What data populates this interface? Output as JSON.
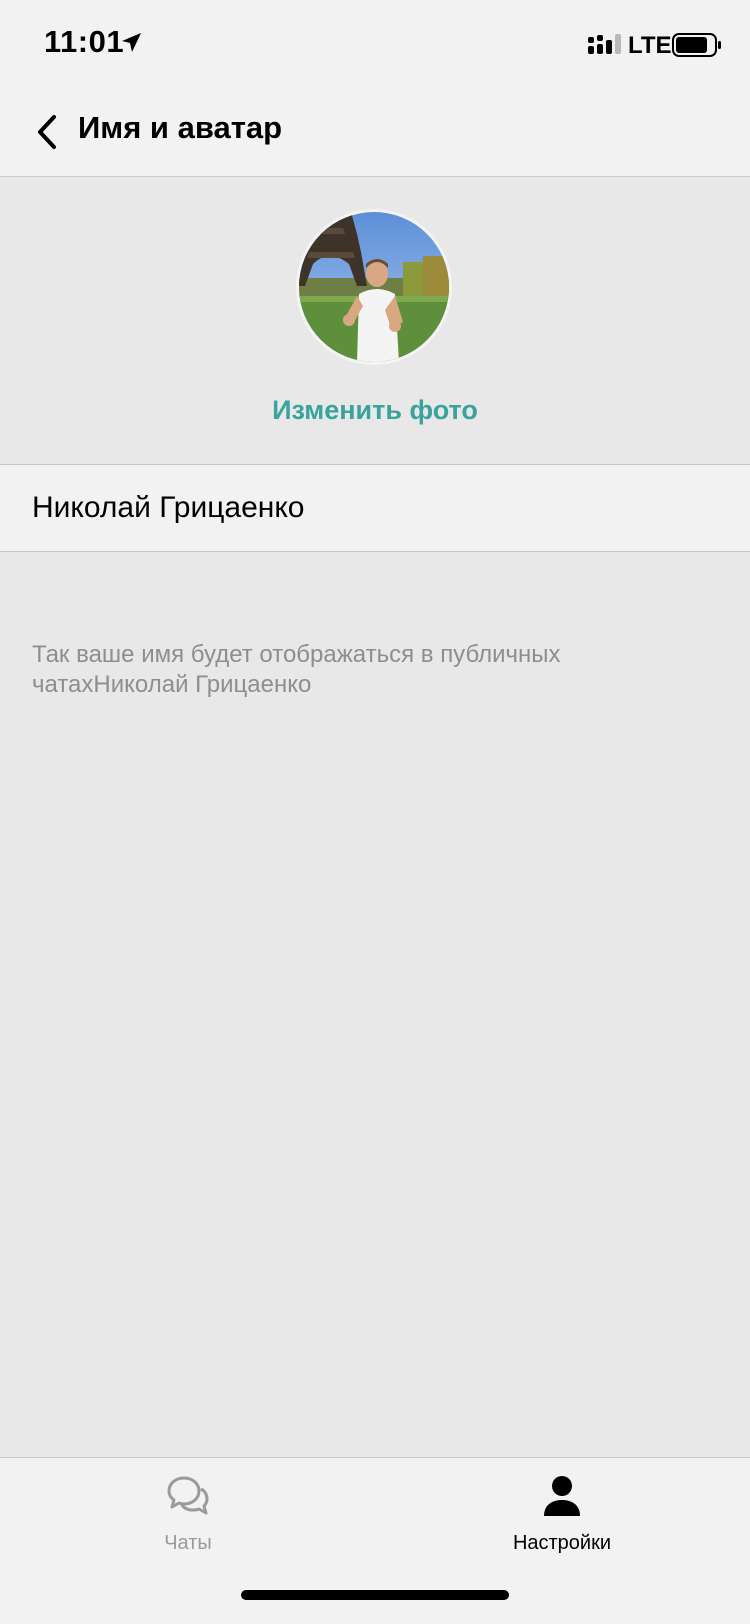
{
  "status_bar": {
    "time": "11:01",
    "network": "LTE",
    "icons": [
      "location-arrow-icon",
      "signal-icon",
      "battery-icon"
    ]
  },
  "nav": {
    "title": "Имя и аватар",
    "back_icon": "chevron-left-icon"
  },
  "profile": {
    "change_photo_label": "Изменить фото",
    "name_value": "Николай Грицаенко",
    "hint": "Так ваше имя будет отображаться в публичных чатахНиколай Грицаенко"
  },
  "tabs": [
    {
      "label": "Чаты",
      "icon": "chat-bubbles-icon",
      "active": false
    },
    {
      "label": "Настройки",
      "icon": "person-icon",
      "active": true
    }
  ],
  "colors": {
    "accent": "#3aa39b",
    "background": "#e8e8e8",
    "bar_background": "#f2f2f2",
    "hint_text": "#8e8e8e"
  }
}
